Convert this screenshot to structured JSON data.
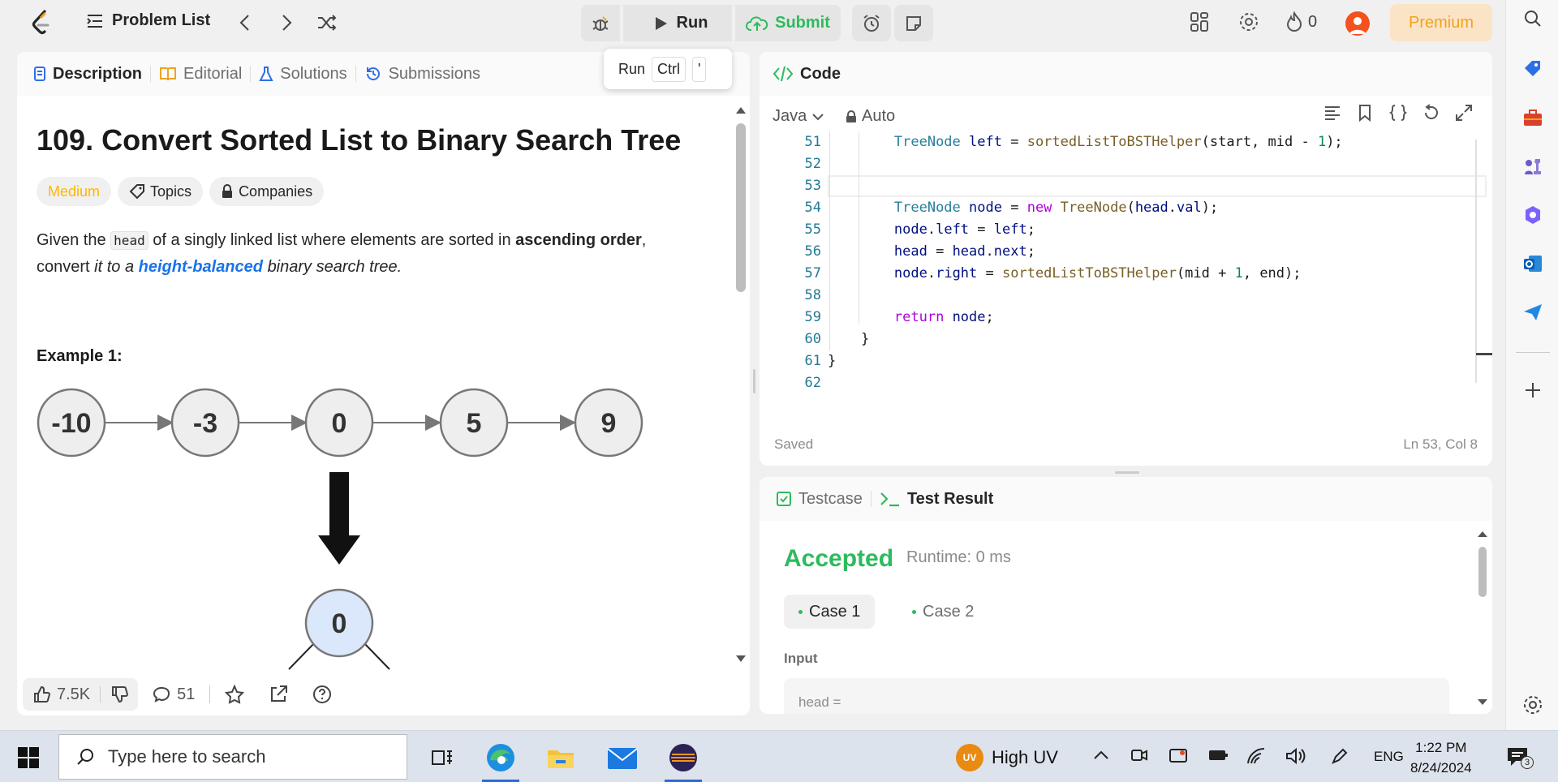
{
  "topbar": {
    "problem_list_label": "Problem List",
    "run_label": "Run",
    "submit_label": "Submit",
    "streak_count": "0",
    "premium_label": "Premium"
  },
  "tooltip": {
    "run": "Run",
    "ctrl": "Ctrl",
    "key": "'"
  },
  "left_tabs": [
    "Description",
    "Editorial",
    "Solutions",
    "Submissions"
  ],
  "problem": {
    "title": "109. Convert Sorted List to Binary Search Tree",
    "difficulty": "Medium",
    "topics_label": "Topics",
    "companies_label": "Companies",
    "desc_given": "Given the",
    "desc_code": "head",
    "desc_mid": "of a singly linked list where elements are sorted in",
    "desc_bold": "ascending order",
    "desc_comma": ",",
    "desc_convert": "convert",
    "desc_it": "it to a",
    "desc_hl": "height-balanced",
    "desc_end": "binary search tree.",
    "example_title": "Example 1:",
    "list_nodes": [
      "-10",
      "-3",
      "0",
      "5",
      "9"
    ],
    "tree_root": "0"
  },
  "footer": {
    "likes": "7.5K",
    "comments": "51"
  },
  "code_panel": {
    "title": "Code",
    "language": "Java",
    "mode": "Auto",
    "status": "Saved",
    "cursor": "Ln 53, Col 8",
    "lines": [
      {
        "n": "51",
        "t": "        TreeNode left = sortedListToBSTHelper(start, mid - 1);"
      },
      {
        "n": "52",
        "t": ""
      },
      {
        "n": "53",
        "t": ""
      },
      {
        "n": "54",
        "t": "        TreeNode node = new TreeNode(head.val);"
      },
      {
        "n": "55",
        "t": "        node.left = left;"
      },
      {
        "n": "56",
        "t": "        head = head.next;"
      },
      {
        "n": "57",
        "t": "        node.right = sortedListToBSTHelper(mid + 1, end);"
      },
      {
        "n": "58",
        "t": ""
      },
      {
        "n": "59",
        "t": "        return node;"
      },
      {
        "n": "60",
        "t": "    }"
      },
      {
        "n": "61",
        "t": "}"
      },
      {
        "n": "62",
        "t": ""
      }
    ]
  },
  "test_panel": {
    "tab_testcase": "Testcase",
    "tab_result": "Test Result",
    "verdict": "Accepted",
    "runtime": "Runtime: 0 ms",
    "case1": "Case 1",
    "case2": "Case 2",
    "input_label": "Input",
    "input_value": "head ="
  },
  "taskbar": {
    "search_placeholder": "Type here to search",
    "uv_badge": "UV",
    "uv_label": "High UV",
    "lang": "ENG",
    "time": "1:22 PM",
    "date": "8/24/2024",
    "notif_count": "3"
  },
  "colors": {
    "accent_green": "#2cbb5d",
    "accent_orange": "#ffb800",
    "premium": "#f0a320"
  }
}
